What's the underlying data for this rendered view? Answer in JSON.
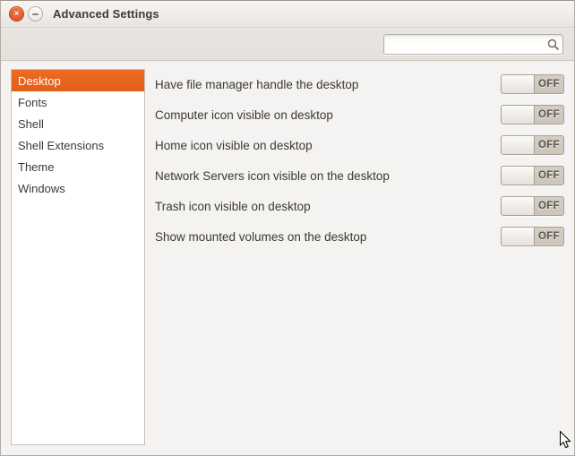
{
  "window": {
    "title": "Advanced Settings",
    "close_label": "×",
    "minimize_label": "",
    "close_icon": "close-icon",
    "minimize_icon": "minimize-icon"
  },
  "toolbar": {
    "search": {
      "value": "",
      "placeholder": "",
      "icon": "search-icon"
    }
  },
  "sidebar": {
    "items": [
      {
        "label": "Desktop",
        "selected": true
      },
      {
        "label": "Fonts",
        "selected": false
      },
      {
        "label": "Shell",
        "selected": false
      },
      {
        "label": "Shell Extensions",
        "selected": false
      },
      {
        "label": "Theme",
        "selected": false
      },
      {
        "label": "Windows",
        "selected": false
      }
    ]
  },
  "settings": {
    "rows": [
      {
        "label": "Have file manager handle the desktop",
        "state": "OFF"
      },
      {
        "label": "Computer icon visible on desktop",
        "state": "OFF"
      },
      {
        "label": "Home icon visible on desktop",
        "state": "OFF"
      },
      {
        "label": "Network Servers icon visible on the desktop",
        "state": "OFF"
      },
      {
        "label": "Trash icon visible on desktop",
        "state": "OFF"
      },
      {
        "label": "Show mounted volumes on the desktop",
        "state": "OFF"
      }
    ]
  },
  "colors": {
    "accent": "#e8641c",
    "window_bg": "#f4f3f1",
    "titlebar_top": "#f7f6f5",
    "panel_bg": "#ffffff",
    "text": "#3c3934"
  },
  "cursor": {
    "icon": "mouse-pointer-icon"
  }
}
